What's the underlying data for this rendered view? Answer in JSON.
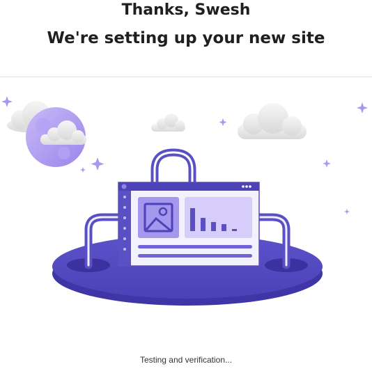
{
  "header": {
    "greeting": "Thanks, Swesh",
    "subtitle": "We're setting up your new site"
  },
  "status": {
    "text": "Testing and verification..."
  },
  "colors": {
    "accent": "#5b4fc4",
    "accent_light": "#d7cdfb",
    "platform": "#5349c0",
    "sparkle": "#a49af0"
  },
  "illustration": {
    "icons": [
      "moon-icon",
      "cloud-icon",
      "sparkle-icon",
      "browser-window-icon",
      "image-icon",
      "bar-chart-icon",
      "bag-handle-icon"
    ]
  }
}
